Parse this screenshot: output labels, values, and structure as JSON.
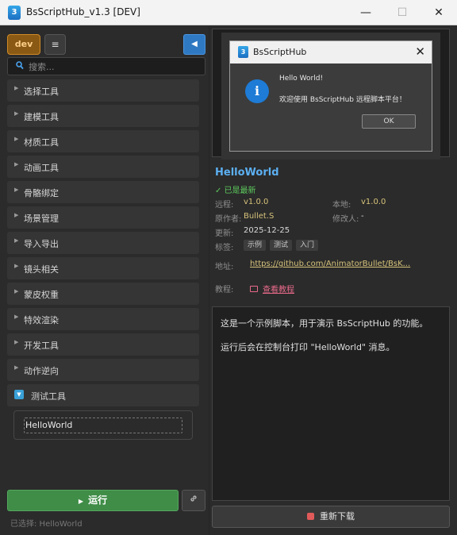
{
  "window": {
    "app_icon_text": "3",
    "title": "BsScriptHub_v1.3 [DEV]",
    "minimize_glyph": "—",
    "maximize_glyph": "☐",
    "close_glyph": "✕"
  },
  "toolbar": {
    "dev_label": "dev",
    "list_icon": "≡",
    "collapse_icon": "◀"
  },
  "search": {
    "placeholder": "搜索...",
    "value": "",
    "icon": "search-icon"
  },
  "categories": [
    {
      "label": "选择工具",
      "expanded": false
    },
    {
      "label": "建模工具",
      "expanded": false
    },
    {
      "label": "材质工具",
      "expanded": false
    },
    {
      "label": "动画工具",
      "expanded": false
    },
    {
      "label": "骨骼绑定",
      "expanded": false
    },
    {
      "label": "场景管理",
      "expanded": false
    },
    {
      "label": "导入导出",
      "expanded": false
    },
    {
      "label": "镜头相关",
      "expanded": false
    },
    {
      "label": "蒙皮权重",
      "expanded": false
    },
    {
      "label": "特效渲染",
      "expanded": false
    },
    {
      "label": "开发工具",
      "expanded": false
    },
    {
      "label": "动作逆向",
      "expanded": false
    },
    {
      "label": "测试工具",
      "expanded": true,
      "items": [
        "HelloWorld"
      ]
    }
  ],
  "run": {
    "label": "运行",
    "icon_glyph": "▶",
    "link_icon": "🔗"
  },
  "selection_status": "已选择: HelloWorld",
  "preview_dialog": {
    "icon_text": "3",
    "title": "BsScriptHub",
    "close_glyph": "✕",
    "info_glyph": "i",
    "message_line1": "Hello World!",
    "message_line2": "欢迎使用 BsScriptHub 远程脚本平台！",
    "ok_label": "OK"
  },
  "details": {
    "name": "HelloWorld",
    "status": "✓ 已是最新",
    "remote_label": "远程:",
    "remote_version": "v1.0.0",
    "local_label": "本地:",
    "local_version": "v1.0.0",
    "author_label": "原作者:",
    "author": "Bullet.S",
    "modifier_label": "修改人:",
    "modifier": "-",
    "updated_label": "更新:",
    "updated": "2025-12-25",
    "tags_label": "标签:",
    "tags": [
      "示例",
      "测试",
      "入门"
    ],
    "address_label": "地址:",
    "address": "https://github.com/AnimatorBullet/BsK...",
    "tutorial_label": "教程:",
    "tutorial_link": "查看教程"
  },
  "description": {
    "line1": "这是一个示例脚本，用于演示 BsScriptHub 的功能。",
    "line2": "运行后会在控制台打印 \"HelloWorld\" 消息。"
  },
  "redownload_label": "重新下载",
  "colors": {
    "accent_blue": "#2f79c2",
    "run_green": "#3f8d47",
    "dev_orange": "#d08a27",
    "name_blue": "#5cb0f2",
    "status_green": "#5cc85c",
    "link_pink": "#e86a8a"
  }
}
